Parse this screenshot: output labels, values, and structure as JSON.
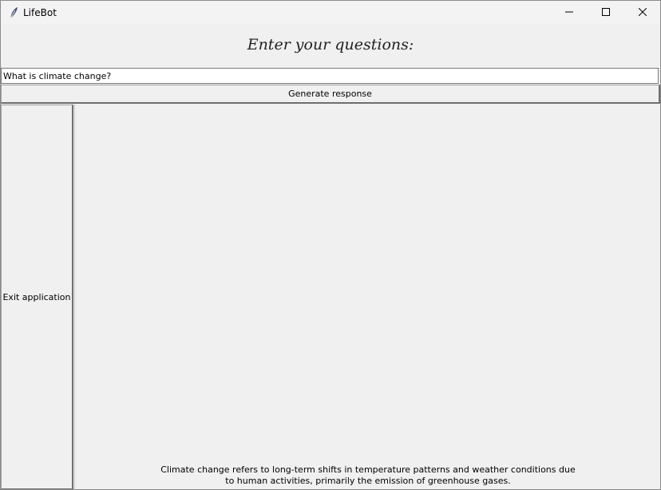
{
  "window": {
    "title": "LifeBot",
    "icon": "feather-icon",
    "controls": [
      "minimize-icon",
      "maximize-icon",
      "close-icon"
    ]
  },
  "header": {
    "label": "Enter your questions:"
  },
  "question": {
    "value": "What is climate change?"
  },
  "buttons": {
    "generate_label": "Generate response",
    "exit_label": "Exit application"
  },
  "response": {
    "line1": "Climate change refers to long-term shifts in temperature patterns and weather conditions due",
    "line2": "to human activities, primarily the emission of greenhouse gases."
  }
}
